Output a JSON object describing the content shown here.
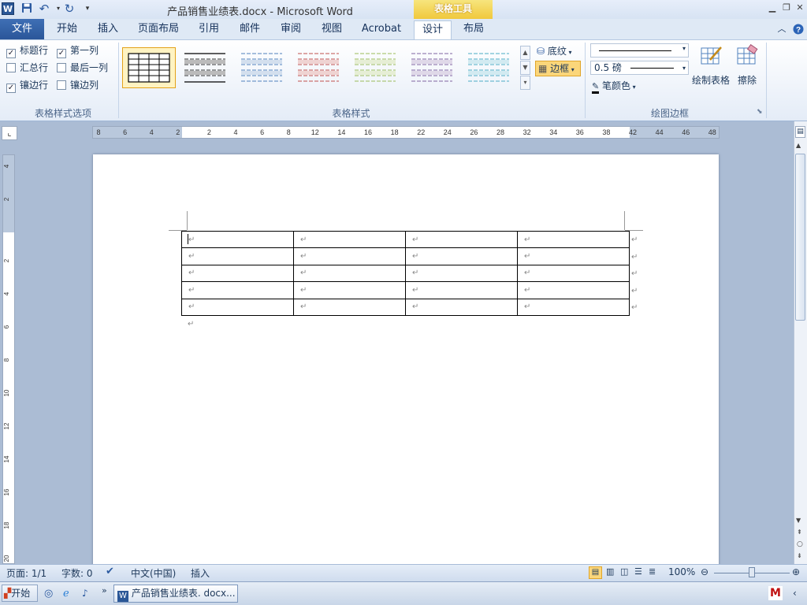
{
  "window": {
    "title": "产品销售业绩表.docx  -  Microsoft Word",
    "context_tab_header": "表格工具",
    "app_icon": "W"
  },
  "tabs": {
    "file": "文件",
    "items": [
      "开始",
      "插入",
      "页面布局",
      "引用",
      "邮件",
      "审阅",
      "视图",
      "Acrobat",
      "设计",
      "布局"
    ],
    "active": "设计"
  },
  "ribbon": {
    "style_options": {
      "label": "表格样式选项",
      "items": [
        {
          "label": "标题行",
          "checked": true
        },
        {
          "label": "第一列",
          "checked": true
        },
        {
          "label": "汇总行",
          "checked": false
        },
        {
          "label": "最后一列",
          "checked": false
        },
        {
          "label": "镶边行",
          "checked": true
        },
        {
          "label": "镶边列",
          "checked": false
        }
      ]
    },
    "table_styles": {
      "label": "表格样式",
      "shading": "底纹",
      "borders": "边框",
      "thumb_colors": [
        "#000000",
        "#000000",
        "#4f81bd",
        "#c0504d",
        "#9bbb59",
        "#8064a2",
        "#4bacc6"
      ]
    },
    "draw_borders": {
      "label": "绘图边框",
      "weight": "0.5 磅",
      "pen_color": "笔颜色",
      "draw_table": "绘制表格",
      "eraser": "擦除"
    }
  },
  "ruler": {
    "top_ticks": [
      "8",
      "6",
      "4",
      "2",
      "2",
      "4",
      "6",
      "8",
      "12",
      "14",
      "16",
      "18",
      "22",
      "24",
      "26",
      "28",
      "32",
      "34",
      "36",
      "38",
      "42",
      "44",
      "46",
      "48"
    ],
    "left_ticks": [
      "4",
      "2",
      "2",
      "4",
      "6",
      "8",
      "10",
      "12",
      "14",
      "16",
      "18",
      "20"
    ]
  },
  "document": {
    "rows": 5,
    "cols": 4,
    "paragraph_mark": "↵"
  },
  "status": {
    "page": "页面: 1/1",
    "words": "字数: 0",
    "language": "中文(中国)",
    "mode": "插入",
    "zoom": "100%"
  },
  "taskbar": {
    "start": "开始",
    "task": "产品销售业绩表. docx..."
  }
}
